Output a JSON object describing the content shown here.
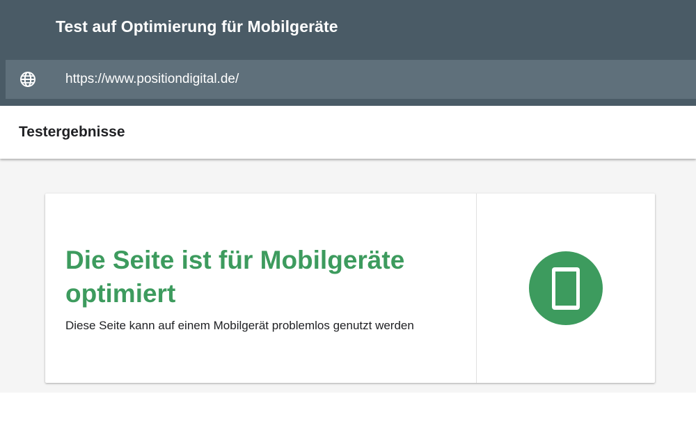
{
  "header": {
    "title": "Test auf Optimierung für Mobilgeräte",
    "url_icon": "globe-icon",
    "url_value": "https://www.positiondigital.de/"
  },
  "results": {
    "title": "Testergebnisse"
  },
  "card": {
    "heading": "Die Seite ist für Mobilgeräte optimiert",
    "description": "Diese Seite kann auf einem Mobilgerät problemlos genutzt werden",
    "status_icon": "mobile-phone-icon"
  },
  "colors": {
    "header_bg": "#4a5b66",
    "url_bar_bg": "#5f707b",
    "success_green": "#3d9b5e",
    "content_bg": "#f5f5f5"
  }
}
